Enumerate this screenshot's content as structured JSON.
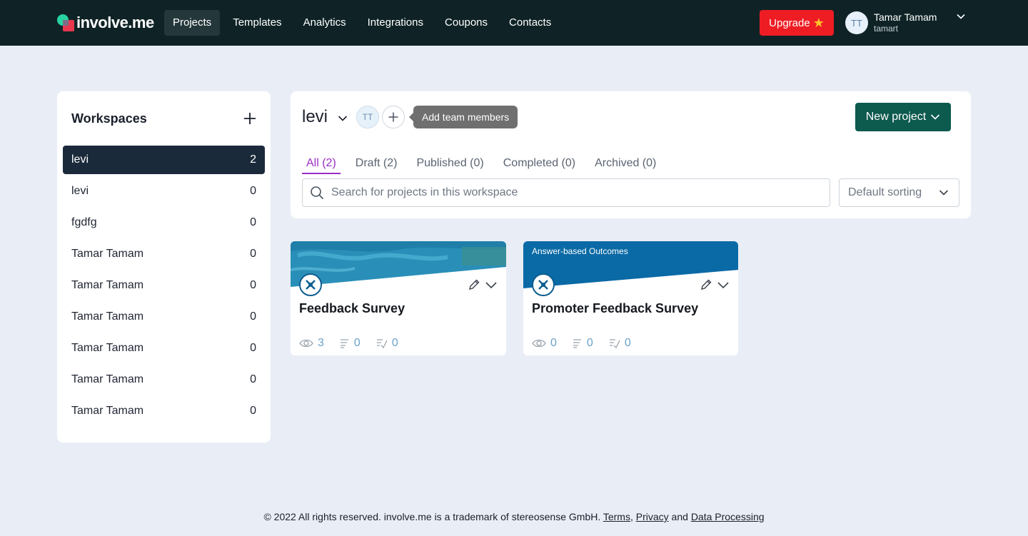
{
  "brand": {
    "name": "involve.me"
  },
  "nav": {
    "items": [
      {
        "label": "Projects",
        "active": true
      },
      {
        "label": "Templates"
      },
      {
        "label": "Analytics"
      },
      {
        "label": "Integrations"
      },
      {
        "label": "Coupons"
      },
      {
        "label": "Contacts"
      }
    ],
    "upgrade_label": "Upgrade",
    "user": {
      "initials": "TT",
      "name": "Tamar Tamam",
      "handle": "tamart"
    }
  },
  "sidebar": {
    "title": "Workspaces",
    "items": [
      {
        "name": "levi",
        "count": "2",
        "active": true
      },
      {
        "name": "levi",
        "count": "0"
      },
      {
        "name": "fgdfg",
        "count": "0"
      },
      {
        "name": "Tamar Tamam",
        "count": "0"
      },
      {
        "name": "Tamar Tamam",
        "count": "0"
      },
      {
        "name": "Tamar Tamam",
        "count": "0"
      },
      {
        "name": "Tamar Tamam",
        "count": "0"
      },
      {
        "name": "Tamar Tamam",
        "count": "0"
      },
      {
        "name": "Tamar Tamam",
        "count": "0"
      }
    ]
  },
  "workspace": {
    "name": "levi",
    "member_initials": "TT",
    "tooltip": "Add team members",
    "new_project_label": "New project",
    "tabs": [
      {
        "label": "All (2)",
        "active": true
      },
      {
        "label": "Draft (2)"
      },
      {
        "label": "Published (0)"
      },
      {
        "label": "Completed (0)"
      },
      {
        "label": "Archived (0)"
      }
    ],
    "search_placeholder": "Search for projects in this workspace",
    "sort_label": "Default sorting"
  },
  "projects": [
    {
      "title": "Feedback Survey",
      "banner_label": "",
      "views": "3",
      "responses": "0",
      "completions": "0"
    },
    {
      "title": "Promoter Feedback Survey",
      "banner_label": "Answer-based Outcomes",
      "views": "0",
      "responses": "0",
      "completions": "0"
    }
  ],
  "footer": {
    "text": "© 2022 All rights reserved. involve.me is a trademark of stereosense GmbH. ",
    "terms": "Terms",
    "comma": ",",
    "privacy": "Privacy",
    "and": " and ",
    "data_processing": "Data Processing"
  },
  "colors": {
    "topbar": "#0f2326",
    "upgrade": "#ee1d24",
    "new_project": "#0d5a4f",
    "active_tab": "#9b2dc4",
    "sidebar_active": "#1b2a3b"
  }
}
